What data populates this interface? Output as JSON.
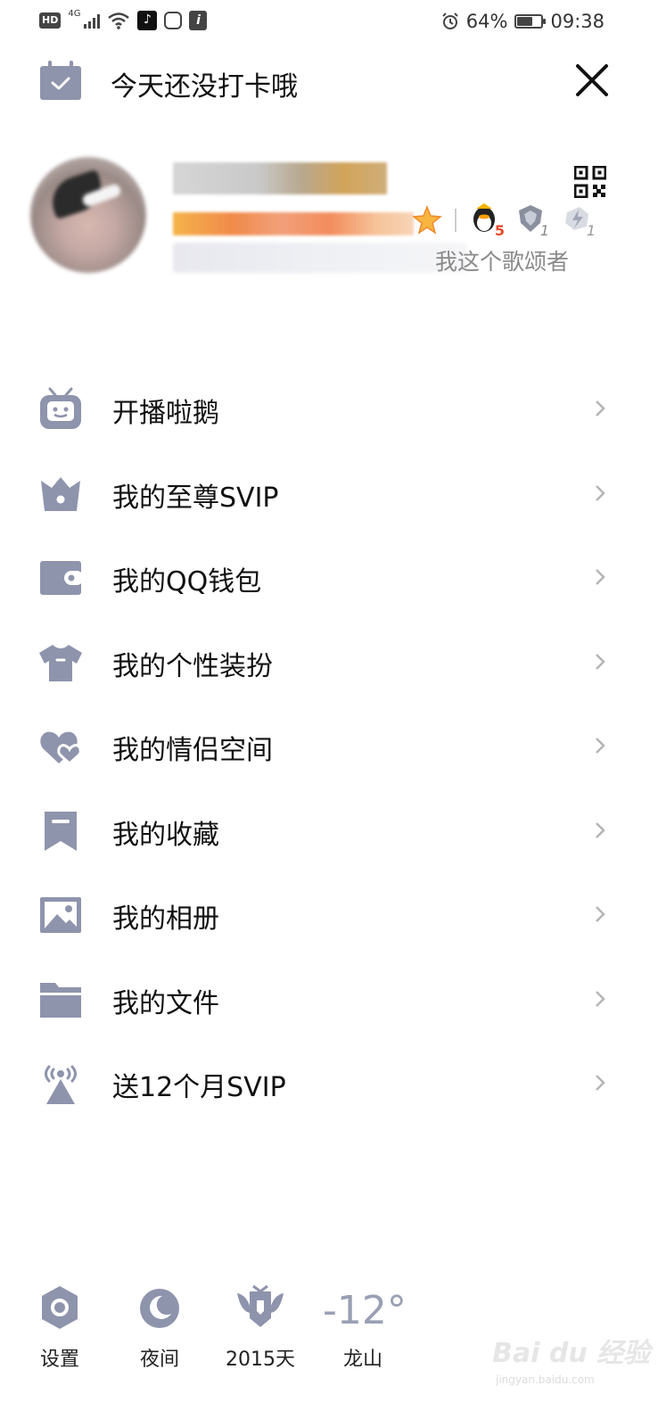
{
  "status_bar": {
    "hd": "HD",
    "network": "4G",
    "tiktok_glyph": "♪",
    "info_glyph": "i",
    "battery_percent": "64%",
    "battery_level": 0.64,
    "time": "09:38"
  },
  "header": {
    "title": "今天还没打卡哦"
  },
  "profile": {
    "signature_visible": "我这个歌颂者",
    "level_badge_qq": "5",
    "level_badge_2": "1",
    "level_badge_3": "1"
  },
  "menu": {
    "items": [
      {
        "label": "开播啦鹅",
        "icon": "tv-robot-icon"
      },
      {
        "label": "我的至尊SVIP",
        "icon": "crown-icon"
      },
      {
        "label": "我的QQ钱包",
        "icon": "wallet-icon"
      },
      {
        "label": "我的个性装扮",
        "icon": "tshirt-icon"
      },
      {
        "label": "我的情侣空间",
        "icon": "hearts-icon"
      },
      {
        "label": "我的收藏",
        "icon": "bookmark-icon"
      },
      {
        "label": "我的相册",
        "icon": "photo-icon"
      },
      {
        "label": "我的文件",
        "icon": "folder-icon"
      },
      {
        "label": "送12个月SVIP",
        "icon": "broadcast-icon"
      }
    ]
  },
  "bottom_bar": {
    "settings_label": "设置",
    "night_label": "夜间",
    "days_label": "2015天",
    "temperature": "-12°",
    "city": "龙山"
  },
  "watermark": {
    "text": "Bai du 经验",
    "url": "jingyan.baidu.com"
  },
  "colors": {
    "icon_gray": "#8e94ac",
    "text": "#111111",
    "chevron": "#b4b4b4"
  }
}
